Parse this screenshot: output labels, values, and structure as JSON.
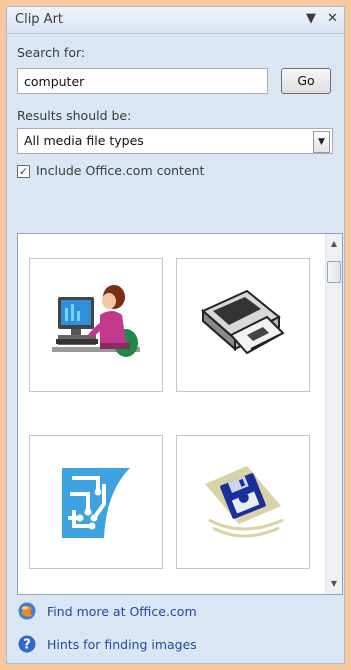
{
  "pane": {
    "title": "Clip Art",
    "menu_icon": "dropdown-arrow-icon",
    "close_icon": "close-icon"
  },
  "search": {
    "label": "Search for:",
    "value": "computer",
    "go_label": "Go"
  },
  "results_type": {
    "label": "Results should be:",
    "selected": "All media file types"
  },
  "include_office": {
    "label": "Include Office.com content",
    "checked": true
  },
  "clips": [
    {
      "icon": "person-at-computer-icon"
    },
    {
      "icon": "floppy-disk-drive-icon"
    },
    {
      "icon": "circuit-board-icon"
    },
    {
      "icon": "floppy-disk-icon"
    }
  ],
  "links": {
    "find_more": "Find more at Office.com",
    "hints": "Hints for finding images"
  },
  "colors": {
    "background": "#f6c8a0",
    "pane": "#dbe6f4",
    "link": "#1c4c9b"
  }
}
